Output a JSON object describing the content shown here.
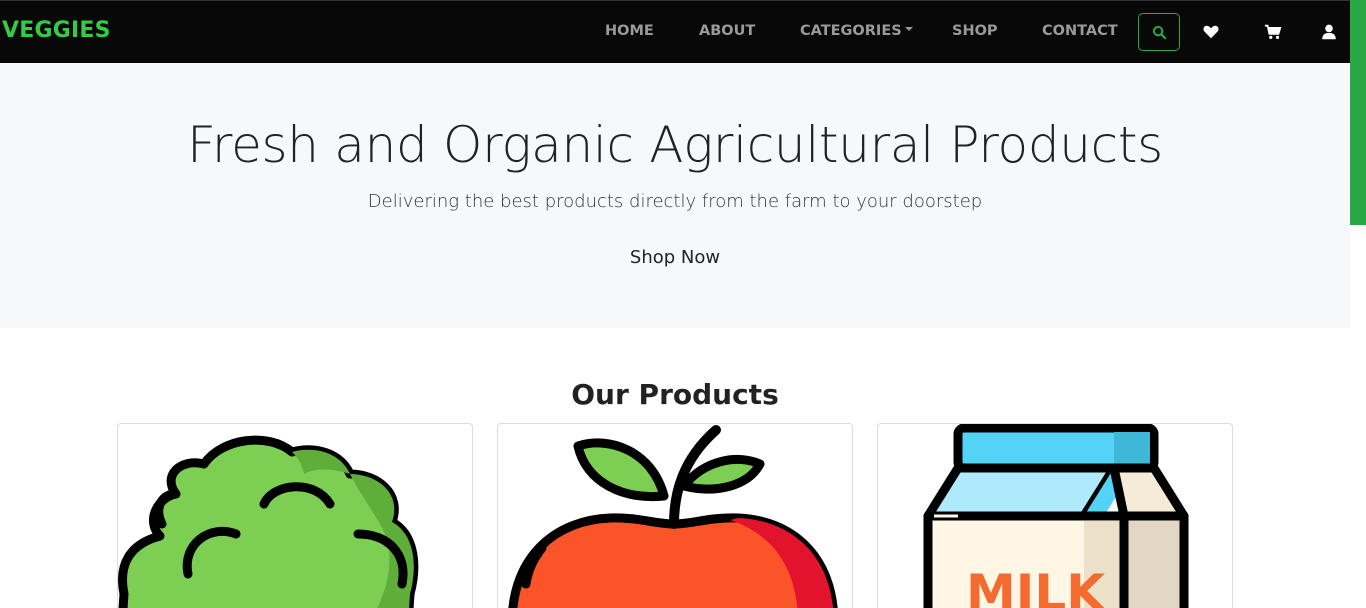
{
  "brand": "VEGGIES",
  "nav": {
    "home": "HOME",
    "about": "ABOUT",
    "categories": "CATEGORIES",
    "shop": "SHOP",
    "contact": "CONTACT"
  },
  "icons": [
    "search-icon",
    "heart-icon",
    "cart-icon",
    "user-icon"
  ],
  "colors": {
    "accent": "#28a745",
    "brand": "#33cc44",
    "navbar": "#080808",
    "hero_bg": "#f7f8fa"
  },
  "hero": {
    "title": "Fresh and Organic Agricultural Products",
    "subtitle": "Delivering the best products directly from the farm to your doorstep",
    "button": "Shop Now"
  },
  "products": {
    "title": "Our Products",
    "items": [
      {
        "image": "broccoli"
      },
      {
        "image": "apple"
      },
      {
        "image": "milk",
        "label": "MILK"
      }
    ]
  }
}
